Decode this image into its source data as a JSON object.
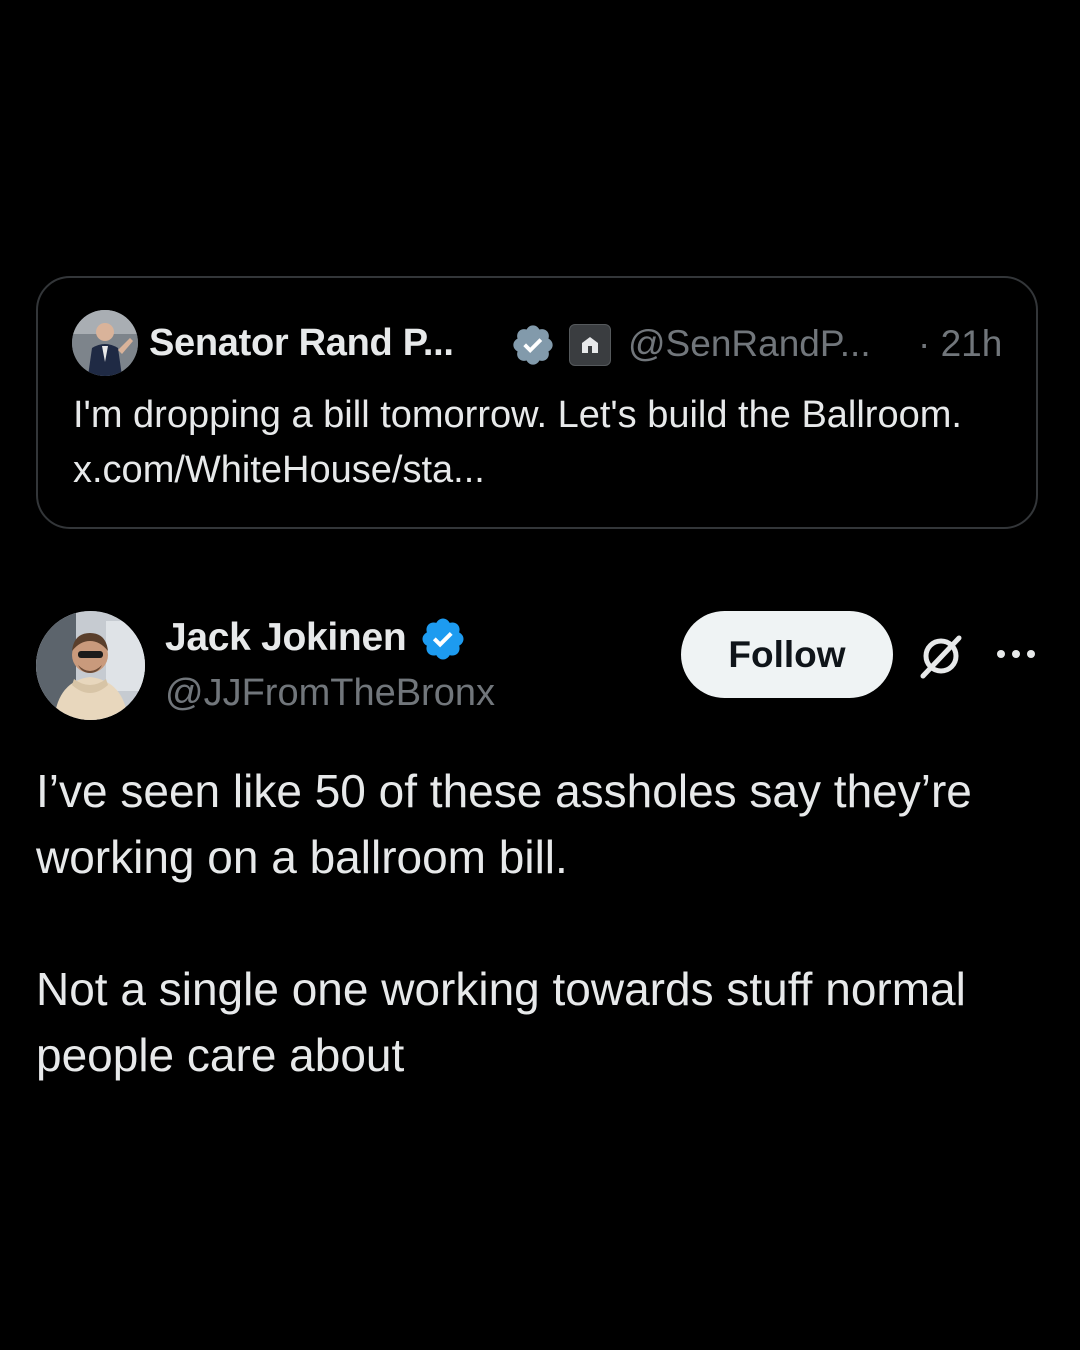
{
  "quoted_tweet": {
    "author_name": "Senator Rand P...",
    "handle": "@SenRandP...",
    "time": "· 21h",
    "text": "I'm dropping a bill tomorrow. Let's build the Ballroom. x.com/WhiteHouse/sta...",
    "verified_icon": "verified-badge-gray-icon",
    "affiliation_icon": "government-building-icon"
  },
  "tweet": {
    "author_name": "Jack Jokinen",
    "handle": "@JJFromTheBronx",
    "verified_icon": "verified-badge-blue-icon",
    "follow_label": "Follow",
    "paragraphs": [
      "I’ve seen like 50 of these assholes say they’re working on a ballroom bill.",
      "Not a single one working towards stuff normal people care about"
    ]
  },
  "icons": {
    "grok": "grok-icon",
    "more": "more-options-icon"
  },
  "colors": {
    "background": "#000000",
    "text_primary": "#e7e9ea",
    "text_secondary": "#71767b",
    "border": "#333639",
    "verified_blue": "#1d9bf0",
    "verified_gray": "#829aab",
    "follow_bg": "#eff3f4"
  }
}
